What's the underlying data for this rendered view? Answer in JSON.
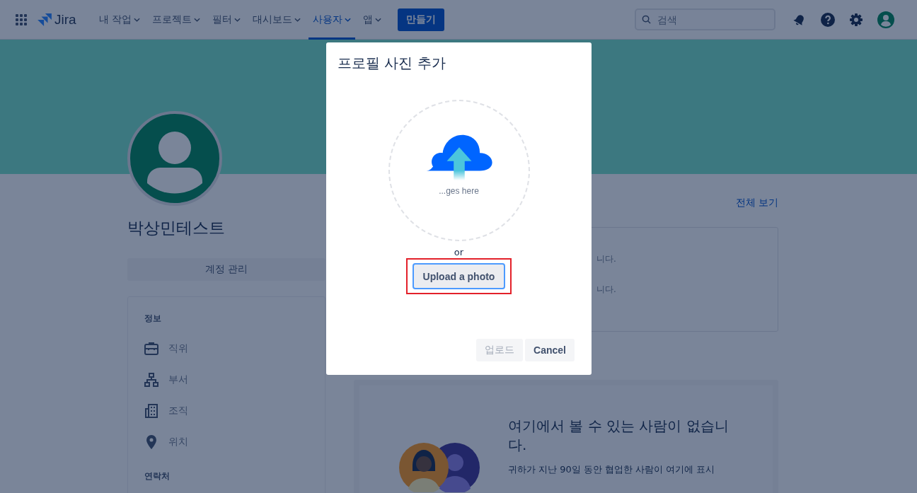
{
  "nav": {
    "product": "Jira",
    "items": [
      {
        "label": "내 작업",
        "selected": false
      },
      {
        "label": "프로젝트",
        "selected": false
      },
      {
        "label": "필터",
        "selected": false
      },
      {
        "label": "대시보드",
        "selected": false
      },
      {
        "label": "사용자",
        "selected": true
      },
      {
        "label": "앱",
        "selected": false
      }
    ],
    "create": "만들기",
    "search": {
      "placeholder": "검색"
    }
  },
  "profile": {
    "name": "박상민테스트",
    "manage": "계정 관리",
    "section": "정보",
    "fields": [
      {
        "kind": "job",
        "label": "직위"
      },
      {
        "kind": "department",
        "label": "부서"
      },
      {
        "kind": "organization",
        "label": "조직"
      },
      {
        "kind": "location",
        "label": "위치"
      }
    ],
    "contact": "연락처"
  },
  "activity": {
    "view_all": "전체 보기",
    "lines": [
      "니다.",
      "니다."
    ]
  },
  "people": {
    "title": "여기에서 볼 수 있는 사람이 없습니다.",
    "text": "귀하가 지난 90일 동안 협업한 사람이 여기에 표시"
  },
  "dialog": {
    "title": "프로필 사진 추가",
    "drop_hint": "...ges here",
    "or": "or",
    "upload_photo": "Upload a photo",
    "highlighted": true,
    "buttons": [
      {
        "label": "업로드",
        "disabled": true
      },
      {
        "label": "Cancel",
        "disabled": false
      }
    ]
  }
}
